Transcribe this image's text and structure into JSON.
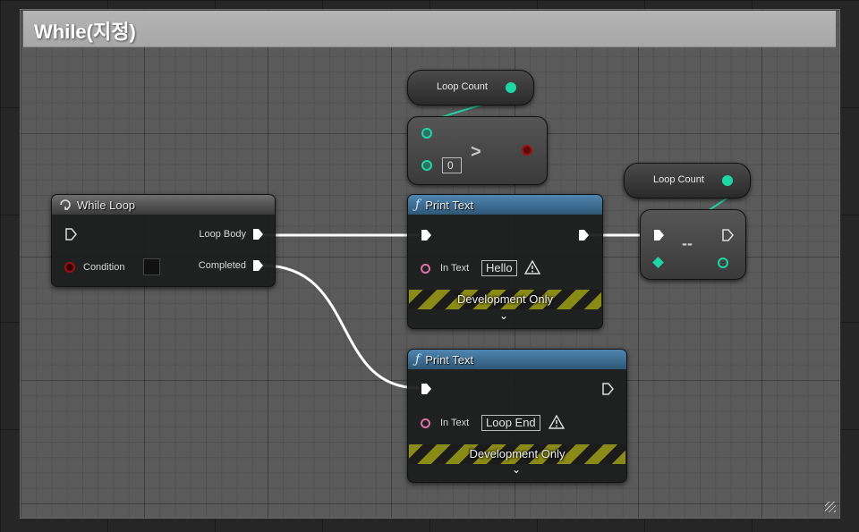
{
  "comment": {
    "title": "While(지정)"
  },
  "while_loop": {
    "title": "While Loop",
    "loop_body_label": "Loop Body",
    "condition_label": "Condition",
    "completed_label": "Completed"
  },
  "loop_count_var_1": {
    "label": "Loop Count"
  },
  "greater_node": {
    "operator": ">",
    "default_value": "0"
  },
  "print_text_1": {
    "title": "Print Text",
    "in_text_label": "In Text",
    "in_text_value": "Hello",
    "dev_only_label": "Development Only"
  },
  "print_text_2": {
    "title": "Print Text",
    "in_text_label": "In Text",
    "in_text_value": "Loop End",
    "dev_only_label": "Development Only"
  },
  "loop_count_var_2": {
    "label": "Loop Count"
  },
  "decrement_node": {
    "operator": "--"
  },
  "colors": {
    "exec_wire": "#ffffff",
    "int_pin": "#1fd6a6",
    "bool_pin": "#8b0000",
    "string_pin": "#e070a8",
    "func_header": "#3f6e94"
  },
  "icons": {
    "while_loop": "loop-icon",
    "print_text": "function-icon",
    "warning": "warning-icon",
    "expand": "chevron-down-icon"
  }
}
